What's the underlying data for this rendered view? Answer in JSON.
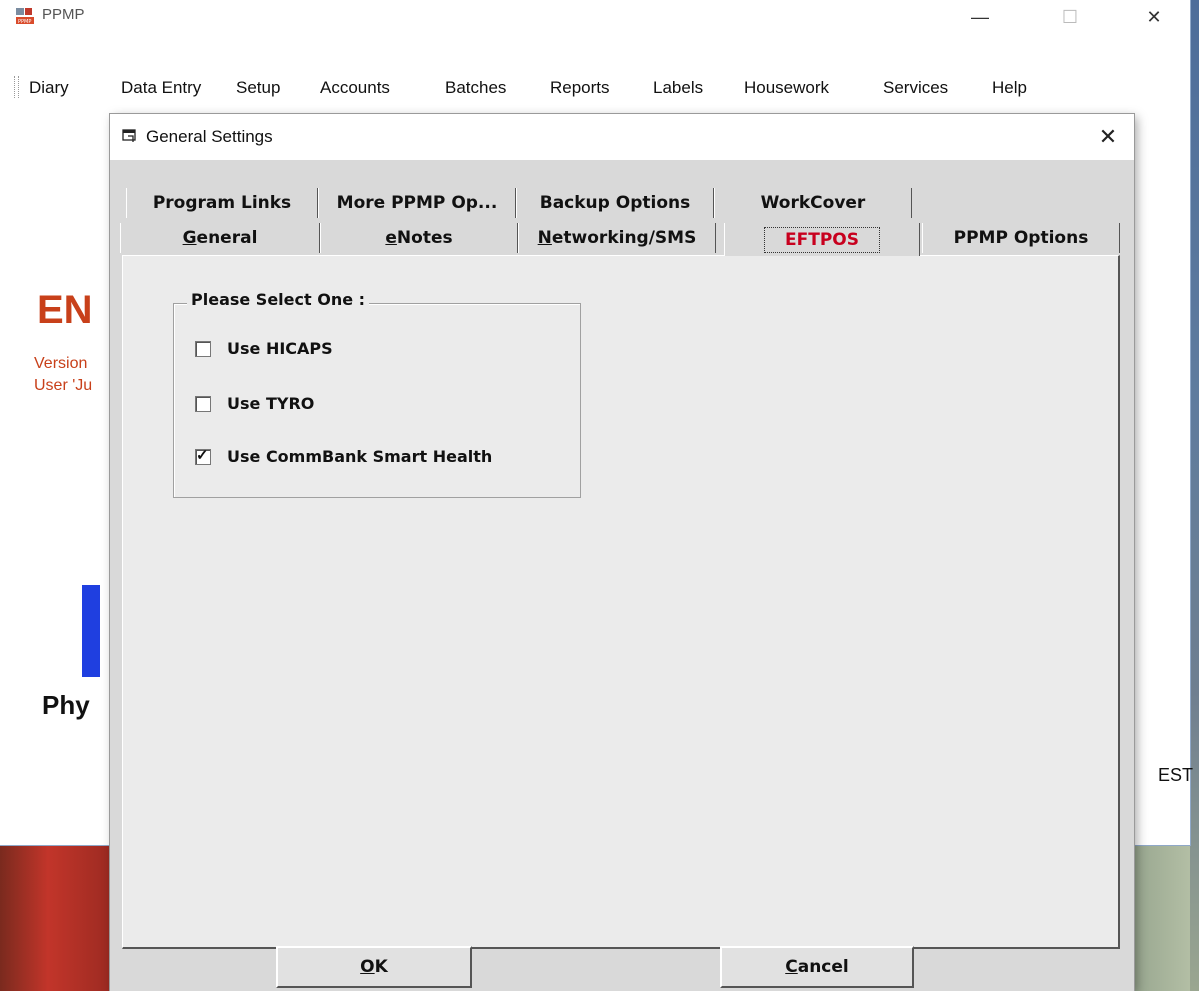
{
  "window": {
    "title": "PPMP",
    "minimize": "—",
    "maximize": "☐",
    "close": "✕"
  },
  "menu": [
    "Diary",
    "Data Entry",
    "Setup",
    "Accounts",
    "Batches",
    "Reports",
    "Labels",
    "Housework",
    "Services",
    "Help"
  ],
  "background": {
    "ent": "EN",
    "version": "Version",
    "user": "User 'Ju",
    "phy": "Phy",
    "est": "EST"
  },
  "dialog": {
    "title": "General Settings",
    "close": "✕",
    "tabs_back": [
      "Program Links",
      "More PPMP Op...",
      "Backup Options",
      "WorkCover"
    ],
    "tabs_front": [
      {
        "pre": "",
        "ul": "G",
        "post": "eneral"
      },
      {
        "pre": "",
        "ul": "e",
        "post": "Notes"
      },
      {
        "pre": "",
        "ul": "N",
        "post": "etworking/SMS"
      },
      {
        "pre": "EFTPOS",
        "ul": "",
        "post": ""
      },
      {
        "pre": "PPMP Options",
        "ul": "",
        "post": ""
      }
    ],
    "active_tab": "EFTPOS",
    "group_title": "Please Select One :",
    "options": [
      {
        "label": "Use HICAPS",
        "checked": false
      },
      {
        "label": "Use TYRO",
        "checked": false
      },
      {
        "label": "Use CommBank Smart Health",
        "checked": true
      }
    ],
    "ok": {
      "ul": "O",
      "post": "K"
    },
    "cancel": {
      "ul": "C",
      "post": "ancel"
    }
  },
  "colors": {
    "active_tab_text": "#c8001e",
    "brand_red": "#c8401a",
    "brand_blue": "#1f3fe0"
  }
}
